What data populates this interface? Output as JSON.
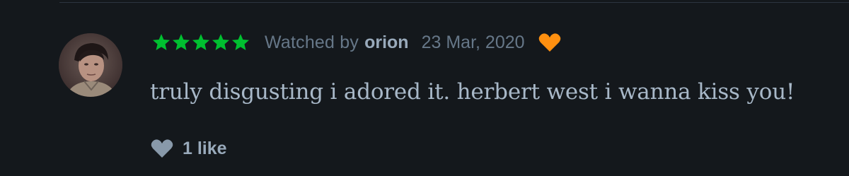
{
  "review": {
    "rating_stars": 5,
    "watched_by_label": "Watched by",
    "username": "orion",
    "date": "23 Mar, 2020",
    "liked": true,
    "body": "truly disgusting i adored it. herbert west i wanna kiss you!",
    "likes_label": "1 like"
  },
  "colors": {
    "background": "#14181c",
    "star_green": "#00c030",
    "heart_orange": "#ff9010",
    "like_icon_gray": "#8899aa",
    "muted_text": "#667788",
    "body_text": "#a8b8c8"
  },
  "icons": {
    "star": "star-icon",
    "liked": "heart-icon",
    "like_button": "heart-icon"
  }
}
